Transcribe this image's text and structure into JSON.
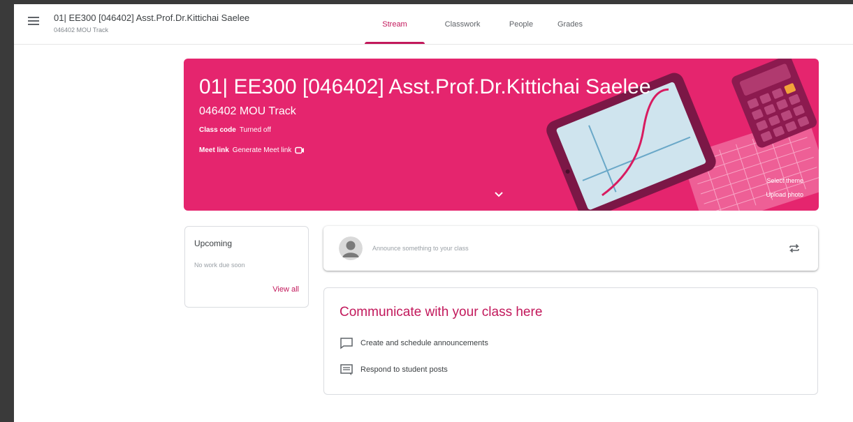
{
  "header": {
    "class_title": "01| EE300 [046402] Asst.Prof.Dr.Kittichai Saelee",
    "class_subtitle": "046402 MOU Track",
    "tabs": [
      {
        "label": "Stream",
        "active": true
      },
      {
        "label": "Classwork",
        "active": false
      },
      {
        "label": "People",
        "active": false
      },
      {
        "label": "Grades",
        "active": false
      }
    ]
  },
  "banner": {
    "title": "01| EE300 [046402] Asst.Prof.Dr.Kittichai Saelee",
    "subtitle": "046402 MOU Track",
    "class_code_label": "Class code",
    "class_code_value": "Turned off",
    "meet_link_label": "Meet link",
    "meet_link_action": "Generate Meet link",
    "select_theme": "Select theme",
    "upload_photo": "Upload photo",
    "color": "#e5256e"
  },
  "upcoming": {
    "title": "Upcoming",
    "empty_text": "No work due soon",
    "view_all": "View all"
  },
  "announce": {
    "placeholder": "Announce something to your class"
  },
  "communicate": {
    "title": "Communicate with your class here",
    "items": [
      {
        "icon": "announcement-icon",
        "label": "Create and schedule announcements"
      },
      {
        "icon": "student-posts-icon",
        "label": "Respond to student posts"
      }
    ]
  },
  "colors": {
    "accent": "#c2185b",
    "banner": "#e5256e"
  }
}
